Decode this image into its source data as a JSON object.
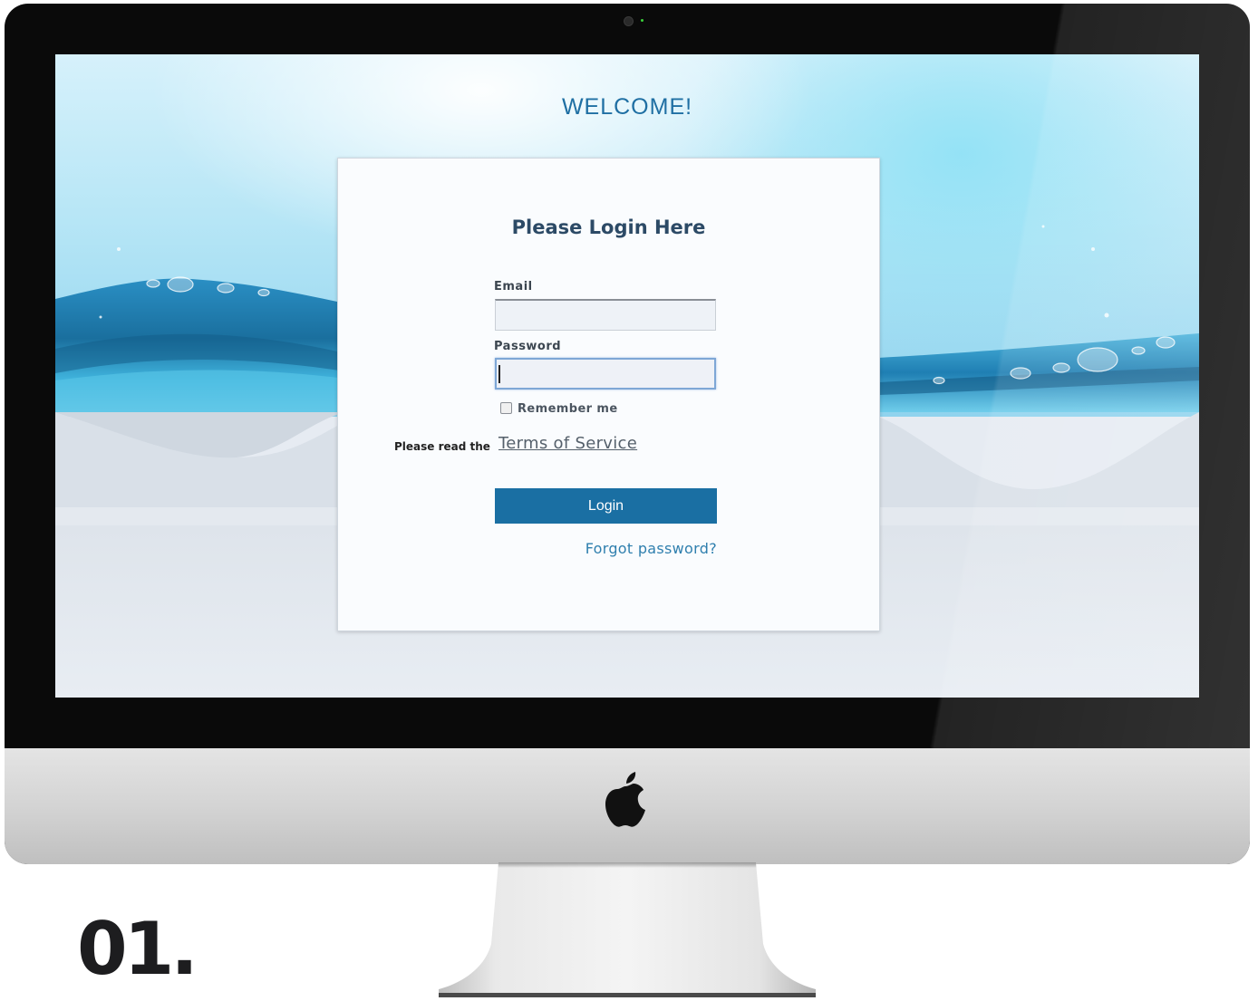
{
  "welcome": {
    "text": "WELCOME!"
  },
  "login_form": {
    "title": "Please Login Here",
    "email_label": "Email",
    "email_value": "",
    "password_label": "Password",
    "password_value": "",
    "remember_label": "Remember me",
    "remember_checked": false,
    "terms_prefix": "Please read the",
    "terms_link": "Terms of Service",
    "login_button": "Login",
    "forgot_link": "Forgot password?"
  },
  "caption": {
    "number": "01."
  },
  "colors": {
    "accent": "#1a6fa3",
    "welcome_text": "#1f6fa3",
    "link": "#2f7fae",
    "screen_background": "#e6ebf2"
  },
  "icons": {
    "logo": "apple-logo-icon",
    "checkbox": "checkbox-icon"
  }
}
